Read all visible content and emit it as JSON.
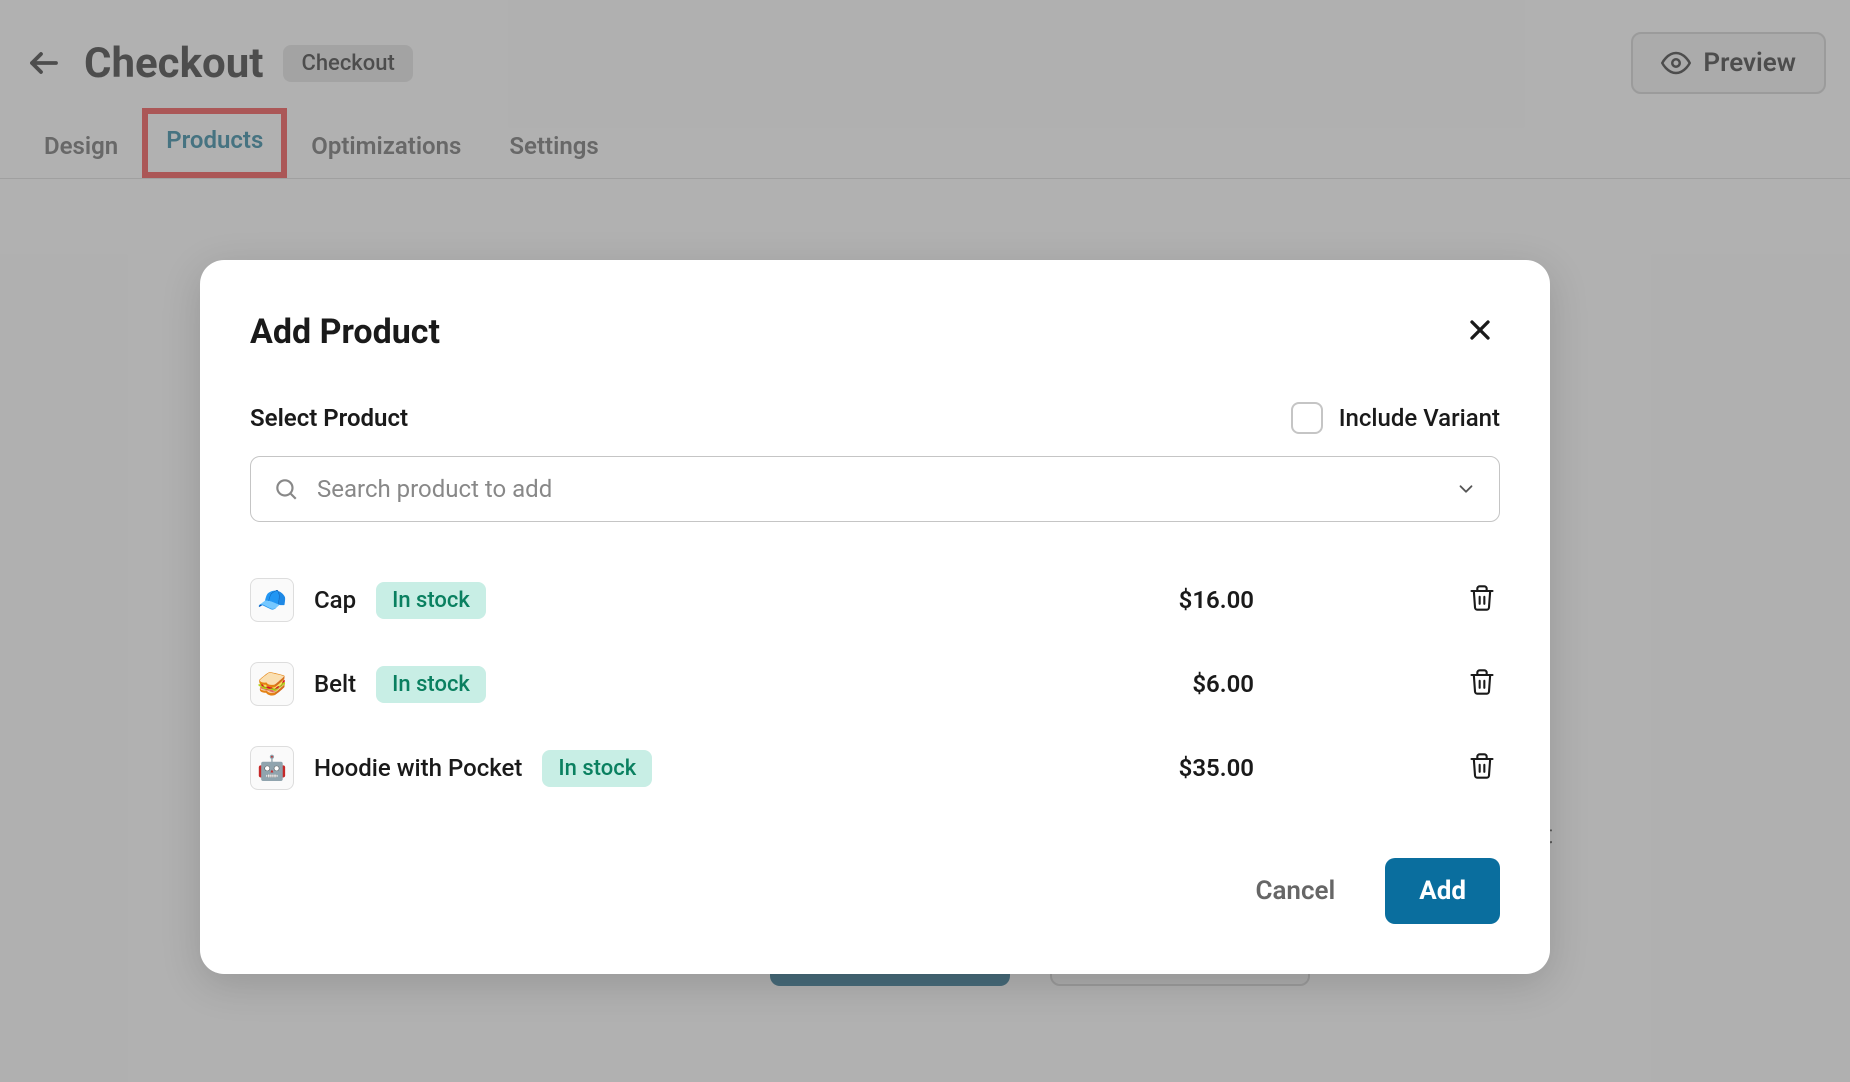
{
  "header": {
    "title": "Checkout",
    "badge": "Checkout",
    "preview_label": "Preview"
  },
  "tabs": [
    {
      "label": "Design"
    },
    {
      "label": "Products"
    },
    {
      "label": "Optimizations"
    },
    {
      "label": "Settings"
    }
  ],
  "bg": {
    "text_fragment": "ut",
    "primary_btn_fragment": "",
    "secondary_btn_fragment": ""
  },
  "modal": {
    "title": "Add Product",
    "section_label": "Select Product",
    "include_variant_label": "Include Variant",
    "search_placeholder": "Search product to add",
    "products": [
      {
        "name": "Cap",
        "stock": "In stock",
        "price": "$16.00",
        "emoji": "🧢"
      },
      {
        "name": "Belt",
        "stock": "In stock",
        "price": "$6.00",
        "emoji": "🥪"
      },
      {
        "name": "Hoodie with Pocket",
        "stock": "In stock",
        "price": "$35.00",
        "emoji": "🤖"
      }
    ],
    "cancel_label": "Cancel",
    "add_label": "Add"
  }
}
